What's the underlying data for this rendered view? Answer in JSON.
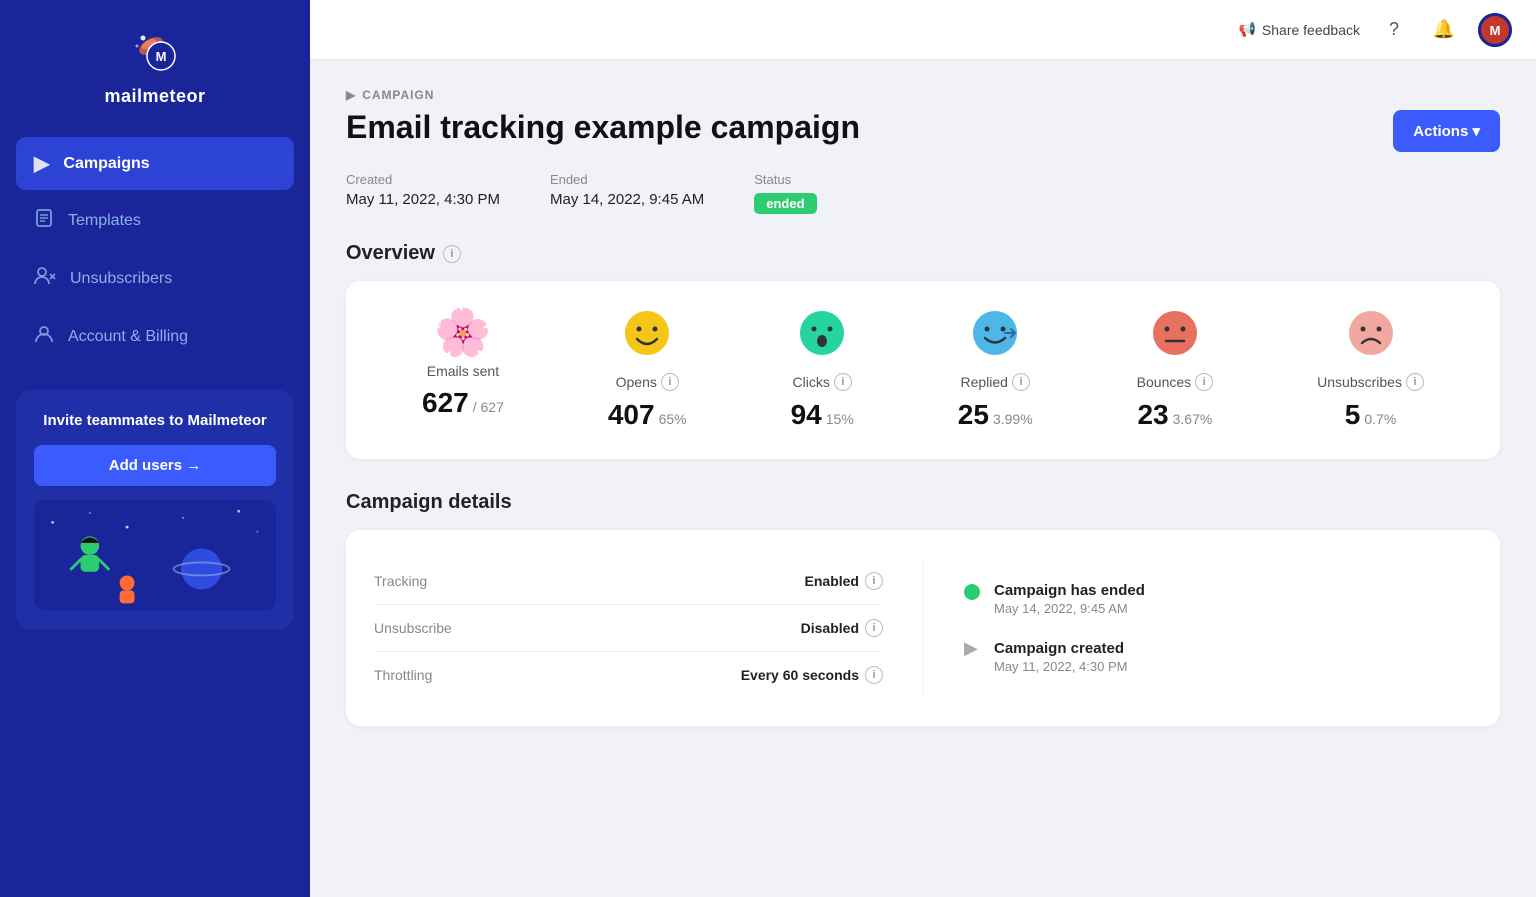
{
  "sidebar": {
    "logo_text": "mailmeteor",
    "nav_items": [
      {
        "id": "campaigns",
        "label": "Campaigns",
        "icon": "▶",
        "active": true
      },
      {
        "id": "templates",
        "label": "Templates",
        "icon": "📄",
        "active": false
      },
      {
        "id": "unsubscribers",
        "label": "Unsubscribers",
        "icon": "👥",
        "active": false
      },
      {
        "id": "account-billing",
        "label": "Account & Billing",
        "icon": "👤",
        "active": false
      }
    ],
    "invite_title": "Invite teammates to Mailmeteor",
    "add_users_label": "Add users →"
  },
  "topbar": {
    "feedback_label": "Share feedback",
    "avatar_initials": "M"
  },
  "campaign": {
    "breadcrumb": "CAMPAIGN",
    "title": "Email tracking example campaign",
    "actions_label": "Actions ▾",
    "created_label": "Created",
    "created_value": "May 11, 2022, 4:30 PM",
    "ended_label": "Ended",
    "ended_value": "May 14, 2022, 9:45 AM",
    "status_label": "Status",
    "status_value": "ended"
  },
  "overview": {
    "section_title": "Overview",
    "stats": [
      {
        "id": "emails-sent",
        "emoji": "🌸",
        "label": "Emails sent",
        "value": "627",
        "sub": "/ 627",
        "show_info": false
      },
      {
        "id": "opens",
        "emoji": "😊",
        "label": "Opens",
        "value": "407",
        "sub": "65%",
        "show_info": true
      },
      {
        "id": "clicks",
        "emoji": "😮",
        "label": "Clicks",
        "value": "94",
        "sub": "15%",
        "show_info": true
      },
      {
        "id": "replied",
        "emoji": "😄",
        "label": "Replied",
        "value": "25",
        "sub": "3.99%",
        "show_info": true
      },
      {
        "id": "bounces",
        "emoji": "😐",
        "label": "Bounces",
        "value": "23",
        "sub": "3.67%",
        "show_info": true
      },
      {
        "id": "unsubscribes",
        "emoji": "😟",
        "label": "Unsubscribes",
        "value": "5",
        "sub": "0.7%",
        "show_info": true
      }
    ]
  },
  "details": {
    "section_title": "Campaign details",
    "rows": [
      {
        "key": "Tracking",
        "value": "Enabled",
        "show_info": true
      },
      {
        "key": "Unsubscribe",
        "value": "Disabled",
        "show_info": true
      },
      {
        "key": "Throttling",
        "value": "Every 60 seconds",
        "show_info": true
      }
    ],
    "timeline": [
      {
        "type": "green",
        "title": "Campaign has ended",
        "date": "May 14, 2022, 9:45 AM"
      },
      {
        "type": "arrow",
        "title": "Campaign created",
        "date": "May 11, 2022, 4:30 PM"
      }
    ]
  }
}
